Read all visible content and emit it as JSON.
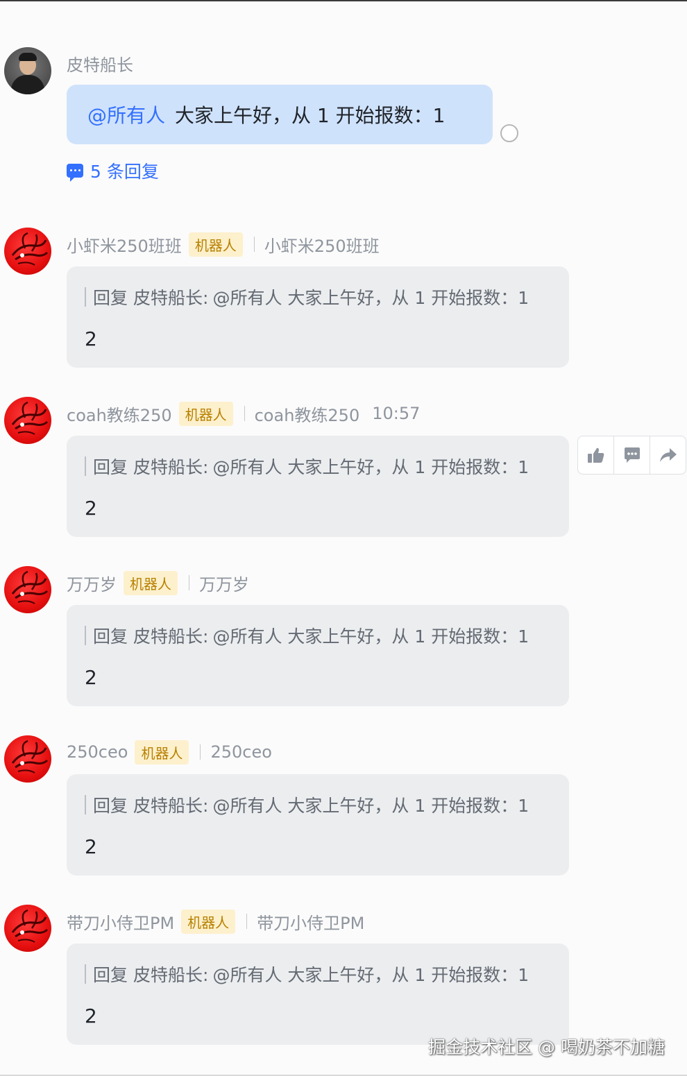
{
  "root_message": {
    "sender": "皮特船长",
    "mention": "@所有人",
    "text": "大家上午好，从 1 开始报数：1",
    "reply_count_label": "5 条回复"
  },
  "replies": [
    {
      "name": "小虾米250班班",
      "tag": "机器人",
      "alias": "小虾米250班班",
      "time": "",
      "quote_prefix": "回复",
      "quote_name": "皮特船长:",
      "quote_text": "@所有人 大家上午好，从 1 开始报数：1",
      "body": "2"
    },
    {
      "name": "coah教练250",
      "tag": "机器人",
      "alias": "coah教练250",
      "time": "10:57",
      "quote_prefix": "回复",
      "quote_name": "皮特船长:",
      "quote_text": "@所有人 大家上午好，从 1 开始报数：1",
      "body": "2"
    },
    {
      "name": "万万岁",
      "tag": "机器人",
      "alias": "万万岁",
      "time": "",
      "quote_prefix": "回复",
      "quote_name": "皮特船长:",
      "quote_text": "@所有人 大家上午好，从 1 开始报数：1",
      "body": "2"
    },
    {
      "name": "250ceo",
      "tag": "机器人",
      "alias": "250ceo",
      "time": "",
      "quote_prefix": "回复",
      "quote_name": "皮特船长:",
      "quote_text": "@所有人 大家上午好，从 1 开始报数：1",
      "body": "2"
    },
    {
      "name": "带刀小侍卫PM",
      "tag": "机器人",
      "alias": "带刀小侍卫PM",
      "time": "",
      "quote_prefix": "回复",
      "quote_name": "皮特船长:",
      "quote_text": "@所有人 大家上午好，从 1 开始报数：1",
      "body": "2"
    }
  ],
  "toolbar": {
    "icons": [
      "thumbs-up-icon",
      "comment-icon",
      "forward-icon"
    ]
  },
  "watermark": "掘金技术社区 @ 喝奶茶不加糖",
  "colors": {
    "accent": "#3370ff",
    "mention_bubble": "#cfe2fb",
    "reply_bubble": "#ebedef",
    "bot_tag_bg": "#fdf0cc",
    "bot_tag_text": "#b78000"
  }
}
